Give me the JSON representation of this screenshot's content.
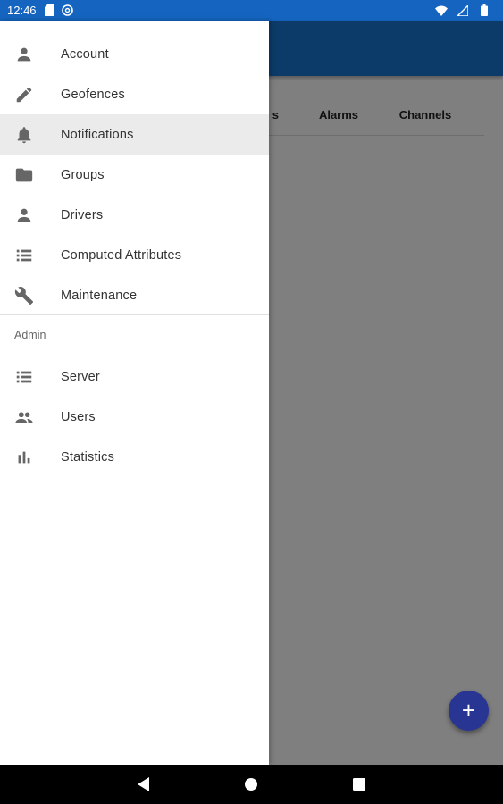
{
  "status_bar": {
    "time": "12:46",
    "icons_left": [
      "sd-card-icon",
      "at-sign-icon"
    ],
    "icons_right": [
      "wifi-icon",
      "signal-icon",
      "battery-icon"
    ]
  },
  "background": {
    "tabs": [
      {
        "label": "s"
      },
      {
        "label": "Alarms"
      },
      {
        "label": "Channels"
      }
    ],
    "fab_icon": "+"
  },
  "drawer": {
    "items": [
      {
        "label": "Account",
        "icon": "person-icon",
        "selected": false
      },
      {
        "label": "Geofences",
        "icon": "pencil-icon",
        "selected": false
      },
      {
        "label": "Notifications",
        "icon": "bell-icon",
        "selected": true
      },
      {
        "label": "Groups",
        "icon": "folder-icon",
        "selected": false
      },
      {
        "label": "Drivers",
        "icon": "person-icon",
        "selected": false
      },
      {
        "label": "Computed Attributes",
        "icon": "list-icon",
        "selected": false
      },
      {
        "label": "Maintenance",
        "icon": "wrench-icon",
        "selected": false
      }
    ],
    "admin_header": "Admin",
    "admin_items": [
      {
        "label": "Server",
        "icon": "list-icon"
      },
      {
        "label": "Users",
        "icon": "people-icon"
      },
      {
        "label": "Statistics",
        "icon": "bar-chart-icon"
      }
    ]
  },
  "colors": {
    "status_bar": "#1565c0",
    "selected_item_bg": "#ebebeb",
    "fab": "#283593"
  }
}
